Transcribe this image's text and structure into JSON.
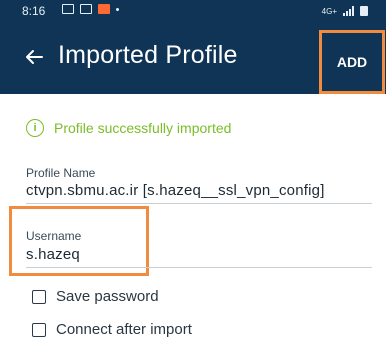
{
  "status_bar": {
    "time": "8:16",
    "network": "4G+"
  },
  "app_bar": {
    "title": "Imported Profile",
    "action_label": "ADD"
  },
  "success": {
    "icon_glyph": "i",
    "message": "Profile successfully imported"
  },
  "profile_name": {
    "label": "Profile Name",
    "value": "ctvpn.sbmu.ac.ir [s.hazeq__ssl_vpn_config]"
  },
  "username": {
    "label": "Username",
    "value": "s.hazeq"
  },
  "options": [
    {
      "label": "Save password",
      "checked": false
    },
    {
      "label": "Connect after import",
      "checked": false
    }
  ],
  "colors": {
    "appbar": "#0f3455",
    "highlight": "#f08b3f",
    "success": "#7bbd28"
  }
}
